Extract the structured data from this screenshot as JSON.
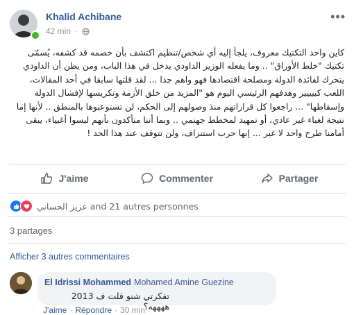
{
  "post": {
    "author": "Khalid Achibane",
    "time": "42 min",
    "body": "كاين واحد التكتيك معروف، يلجأ إليه أي شخص/تنظيم اكتشف بأن خصمه قد كشفه، يُسمّى تكتيك \"خلط الأوراق\" .. وما يفعله الوزير الداودي يدخل في هذا الباب، ومن يظن أن الداودي يتحرك لفائدة الدولة ومصلحة اقتصادها فهو واهم جدا ... لقد قلتها سابقا في أحد المقالات، اللعب كبيييير وهدفهم الرئيسي اليوم هو \"المزيد من خلق الأزمة وتكريسها لإفشال الدولة وإسقاطها\" ... راجعوا كل قراراتهم منذ وصولهم إلى الحكم، لن تستوعبوها بالمنطق .. لأنها إما نتيجة لغباء غير عادي، أو تمهيد لمخطط جهنمي .. وبما أننا متأكدون بأنهم ليسوا أغبياء، يبقى أمامنا طرح واحد لا غير ... إنها حرب استنزاف، ولن تتوقف عند هذا الحد !"
  },
  "actions": {
    "like": "J'aime",
    "comment": "Commenter",
    "share": "Partager"
  },
  "reactions": {
    "text": "عزيز الحساني and 21 autres personnes"
  },
  "shares": "3 partages",
  "more_comments": "Afficher 3 autres commentaires",
  "comment": {
    "author": "El Idrissi Mohammed",
    "mention": "Mohamed Amine Guezine",
    "text": "تفكرتي شنو قلت ف 2013 ههههه؟",
    "like": "J'aime",
    "sep1": "·",
    "reply": "Répondre",
    "sep2": "·",
    "time": "30 min"
  },
  "colors": {
    "link": "#385898",
    "muted": "#606770",
    "like": "#1877f2",
    "love": "#f33e58",
    "online": "#42b72a"
  }
}
